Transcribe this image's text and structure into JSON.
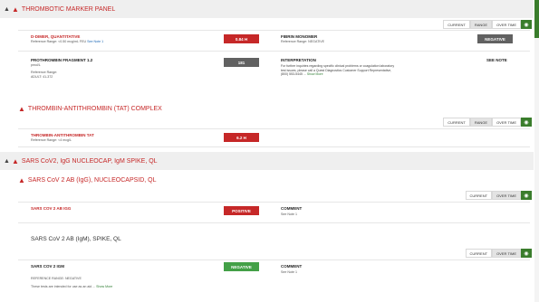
{
  "panel1": {
    "title": "THROMBOTIC MARKER PANEL",
    "toggle": {
      "current": "CURRENT",
      "range": "RANGE",
      "over_time": "OVER TIME"
    },
    "tests": [
      {
        "name": "D-DIMER, QUANTITATIVE",
        "ref": "Reference Range: <0.50 mcg/mL FEU",
        "ref_link": "See Note 1",
        "value": "0.84 H"
      },
      {
        "name": "PROTHROMBIN FRAGMENT 1.2",
        "unit": "pmol/L",
        "ref_label": "Reference Range:",
        "ref_value": "ADULT: 41-372",
        "value": "181"
      }
    ],
    "fibrin": {
      "name": "FIBRIN MONOMER",
      "ref": "Reference Range: NEGATIVE",
      "value": "NEGATIVE"
    },
    "interpretation": {
      "label": "INTERPRETATION",
      "text": "For further inquiries regarding specific clinical problems or coagulation laboratory test issues, please call a Quest Diagnostics Customer Support Representative, (800) 553-5445 ...",
      "more": "Show More",
      "value": "SEE NOTE"
    }
  },
  "panel2": {
    "title": "THROMBIN-ANTITHROMBIN (TAT) COMPLEX",
    "toggle": {
      "current": "CURRENT",
      "range": "RANGE",
      "over_time": "OVER TIME"
    },
    "test": {
      "name": "THROMBIN-ANTITHROMBIN TAT",
      "ref": "Reference Range: <4 mcg/L",
      "value": "6.2 H"
    }
  },
  "panel3": {
    "title": "SARS CoV2, IgG NUCLEOCAP, IgM SPIKE, QL",
    "sub1": {
      "title": "SARS CoV 2 AB (IgG), NUCLEOCAPSID, QL",
      "toggle": {
        "current": "CURRENT",
        "over_time": "OVER TIME"
      },
      "test": {
        "name": "SARS CoV 2 AB IGG",
        "value": "POSITIVE"
      },
      "comment": {
        "label": "COMMENT",
        "link": "See Note 1"
      }
    },
    "sub2": {
      "title": "SARS CoV 2 AB (IgM), SPIKE, QL",
      "toggle": {
        "current": "CURRENT",
        "over_time": "OVER TIME"
      },
      "test": {
        "name": "SARS CoV 2 IGM",
        "value": "NEGATIVE",
        "ref": "REFERENCE RANGE: NEGATIVE",
        "note": "These tests are intended for use as an aid ...",
        "more": "Show More"
      },
      "comment": {
        "label": "COMMENT",
        "link": "See Note 1"
      }
    }
  },
  "colors": {
    "red": "#c62828",
    "green": "#43a047",
    "gray": "#616161",
    "eye": "#3a7d2c"
  },
  "icons": {
    "collapse": "chevron-up-icon",
    "warning": "warning-triangle-icon",
    "view": "eye-icon"
  }
}
